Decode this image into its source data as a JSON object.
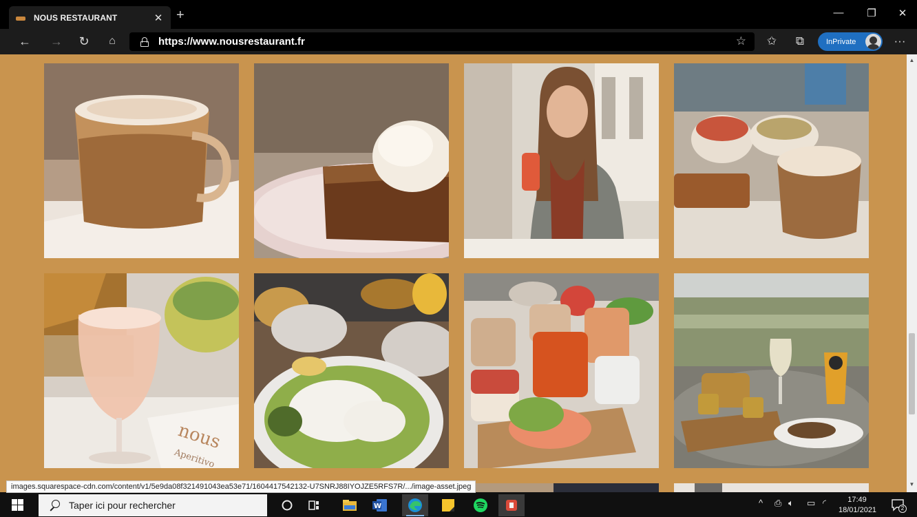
{
  "browser": {
    "tab_title": "NOUS RESTAURANT",
    "url": "https://www.nousrestaurant.fr",
    "inprivate_label": "InPrivate",
    "status_url": "images.squarespace-cdn.com/content/v1/5e9da08f321491043ea53e71/1604417542132-U7SNRJ88IYOJZE5RFS7R/.../image-asset.jpeg"
  },
  "gallery": {
    "photos": [
      {
        "subject": "cappuccino in glass mug"
      },
      {
        "subject": "brownie with ice cream scoop"
      },
      {
        "subject": "woman holding pink drink"
      },
      {
        "subject": "latte with brunch bowls"
      },
      {
        "subject": "spritz with nous aperitivo card",
        "text_1": "nous",
        "text_2": "Aperitivo"
      },
      {
        "subject": "avocado salad with feta"
      },
      {
        "subject": "brunch table with drinks and salmon toast"
      },
      {
        "subject": "canal terrace with beer and snacks"
      }
    ]
  },
  "taskbar": {
    "search_placeholder": "Taper ici pour rechercher",
    "time": "17:49",
    "date": "18/01/2021",
    "notification_count": "2"
  },
  "colors": {
    "page_background": "#c9944e",
    "inprivate_badge": "#1f6fc1"
  }
}
